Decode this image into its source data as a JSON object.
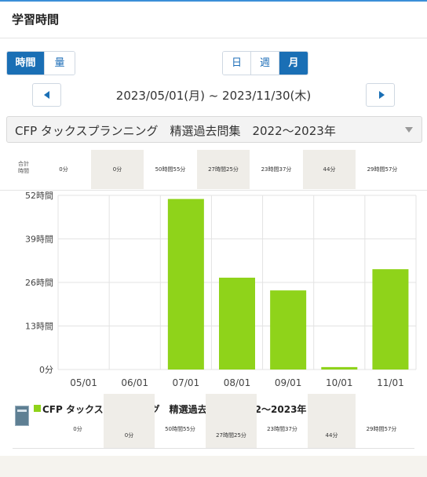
{
  "header": {
    "title": "学習時間"
  },
  "toggle_metric": {
    "time_label": "時間",
    "amount_label": "量"
  },
  "toggle_period": {
    "day_label": "日",
    "week_label": "週",
    "month_label": "月"
  },
  "nav": {
    "range_label": "2023/05/01(月) ~ 2023/11/30(木)"
  },
  "course_select": {
    "selected": "CFP タックスプランニング　精選過去問集　2022〜2023年"
  },
  "totals": {
    "label_line1": "合計",
    "label_line2": "時間",
    "values": [
      "0分",
      "0分",
      "50時間55分",
      "27時間25分",
      "23時間37分",
      "44分",
      "29時間57分"
    ]
  },
  "legend": {
    "course_name": "CFP タックスプランニング　精選過去問集　2022〜2023年",
    "values": [
      "0分",
      "0分",
      "50時間55分",
      "27時間25分",
      "23時間37分",
      "44分",
      "29時間57分"
    ]
  },
  "colors": {
    "accent": "#1a6fb5",
    "bar": "#8fd31a",
    "shade": "#efede8"
  },
  "chart_data": {
    "type": "bar",
    "categories": [
      "05/01",
      "06/01",
      "07/01",
      "08/01",
      "09/01",
      "10/01",
      "11/01"
    ],
    "series": [
      {
        "name": "CFP タックスプランニング　精選過去問集　2022〜2023年",
        "values": [
          0,
          0,
          50.92,
          27.42,
          23.62,
          0.73,
          29.95
        ]
      }
    ],
    "y_ticks": [
      "0分",
      "13時間",
      "26時間",
      "39時間",
      "52時間"
    ],
    "ylim": [
      0,
      52
    ],
    "grid": true
  }
}
